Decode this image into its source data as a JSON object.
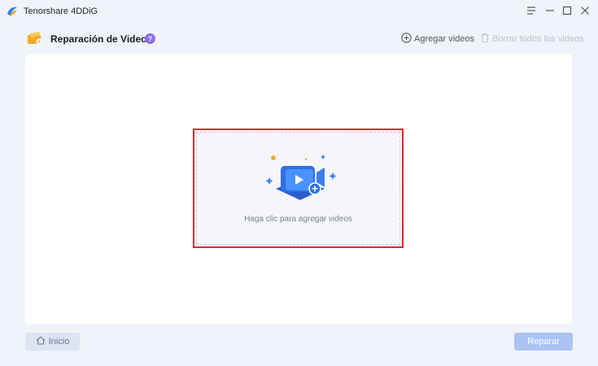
{
  "window": {
    "title": "Tenorshare 4DDiG",
    "controls": [
      "menu-icon",
      "minimize-icon",
      "maximize-icon",
      "close-icon"
    ]
  },
  "header": {
    "title": "Reparación de Videos",
    "help_badge": "?",
    "add_videos_label": "Agregar videos",
    "clear_videos_label": "Borrar todos los videos"
  },
  "drop_zone": {
    "text": "Haga clic para agregar videos"
  },
  "footer": {
    "home_label": "Inicio",
    "repair_label": "Reparar"
  },
  "colors": {
    "accent": "#3a7ff0",
    "highlight_border": "#e0262d",
    "help_badge": "#8b6cf0",
    "repair_disabled": "#a9c3f5"
  }
}
